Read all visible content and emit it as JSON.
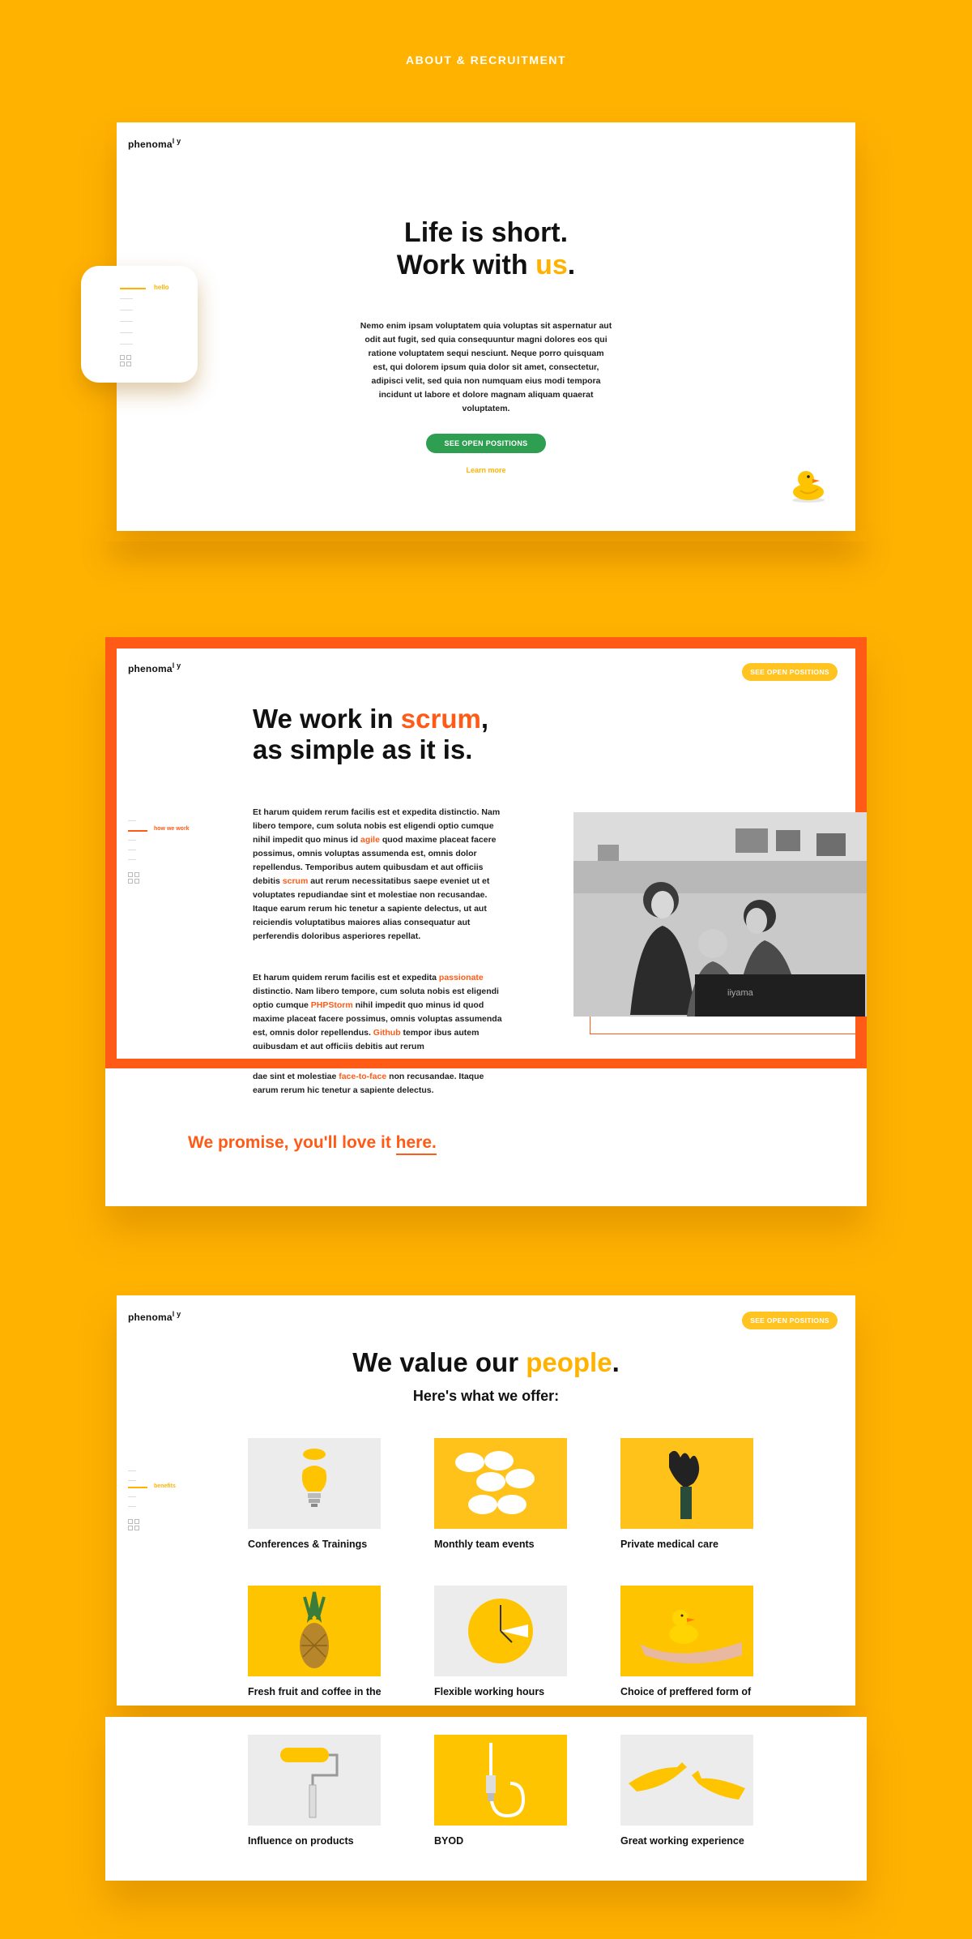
{
  "header": {
    "title": "ABOUT & RECRUITMENT"
  },
  "brand": {
    "logo_text": "phenoma",
    "logo_super": "l y"
  },
  "colors": {
    "background": "#FFB200",
    "accent_yellow": "#FFB200",
    "accent_orange": "#FF5A16",
    "green": "#2E9E50"
  },
  "hero": {
    "title_line1": "Life is short.",
    "title_line2_prefix": "Work with ",
    "title_line2_accent": "us",
    "title_line2_suffix": ".",
    "paragraph": "Nemo enim ipsam voluptatem quia voluptas sit aspernatur aut odit aut fugit, sed quia consequuntur magni dolores eos qui ratione voluptatem sequi nesciunt. Neque porro quisquam est, qui dolorem ipsum quia dolor sit amet, consectetur, adipisci velit, sed quia non numquam eius modi tempora incidunt ut labore et dolore magnam aliquam quaerat voluptatem.",
    "cta_label": "SEE OPEN POSITIONS",
    "learn_more": "Learn more",
    "nav_active_label": "hello"
  },
  "scrum": {
    "cta_label": "SEE OPEN POSITIONS",
    "title_line1_prefix": "We work in ",
    "title_line1_accent": "scrum",
    "title_line1_suffix": ",",
    "title_line2": "as simple as it is.",
    "nav_active_label": "how we work",
    "p1_a": "Et harum quidem rerum facilis est et expedita distinctio. Nam libero tempore, cum soluta nobis est eligendi optio cumque nihil impedit quo minus id ",
    "p1_hl1": "agile",
    "p1_b": " quod maxime placeat facere possimus, omnis voluptas assumenda est, omnis dolor repellendus. Temporibus autem quibusdam et aut officiis debitis ",
    "p1_hl2": "scrum",
    "p1_c": " aut rerum necessitatibus saepe eveniet ut et voluptates repudiandae sint et molestiae non recusandae. Itaque earum rerum hic tenetur a sapiente delectus, ut aut reiciendis voluptatibus maiores alias consequatur aut perferendis doloribus asperiores repellat.",
    "p2_a": "Et harum quidem rerum facilis est et expedita ",
    "p2_hl1": "passionate",
    "p2_b": " distinctio. Nam libero tempore, cum soluta nobis est eligendi optio cumque ",
    "p2_hl2": "PHPStorm",
    "p2_c": " nihil impedit quo minus id quod maxime placeat facere possimus, omnis voluptas assumenda est, omnis dolor repellendus. ",
    "p2_hl3": "Github",
    "p2_d": " tempor ibus autem quibusdam et aut officiis debitis aut rerum",
    "p2_e": "dae sint et molestiae ",
    "p2_hl4": "face-to-face",
    "p2_f": "  non recusandae. Itaque earum rerum hic tenetur a sapiente delectus.",
    "promise_prefix": "We promise, you'll love it ",
    "promise_link": "here."
  },
  "people": {
    "cta_label": "SEE OPEN POSITIONS",
    "title_prefix": "We value our ",
    "title_accent": "people",
    "title_suffix": ".",
    "subtitle": "Here's what we offer:",
    "nav_active_label": "benefits",
    "benefits": [
      {
        "label": "Conferences & Trainings",
        "icon": "lightbulb-lemon"
      },
      {
        "label": "Monthly team events",
        "icon": "sunglasses"
      },
      {
        "label": "Private medical care",
        "icon": "glove-hand"
      },
      {
        "label": "Fresh fruit and coffee in the office",
        "icon": "pineapple"
      },
      {
        "label": "Flexible working hours",
        "icon": "clock"
      },
      {
        "label": "Choice of preffered form of cooperation",
        "icon": "rubber-duck-hand"
      },
      {
        "label": "Influence on products",
        "icon": "paint-roller"
      },
      {
        "label": "BYOD",
        "icon": "usb-cable"
      },
      {
        "label": "Great working experience",
        "icon": "yellow-hands"
      }
    ]
  }
}
